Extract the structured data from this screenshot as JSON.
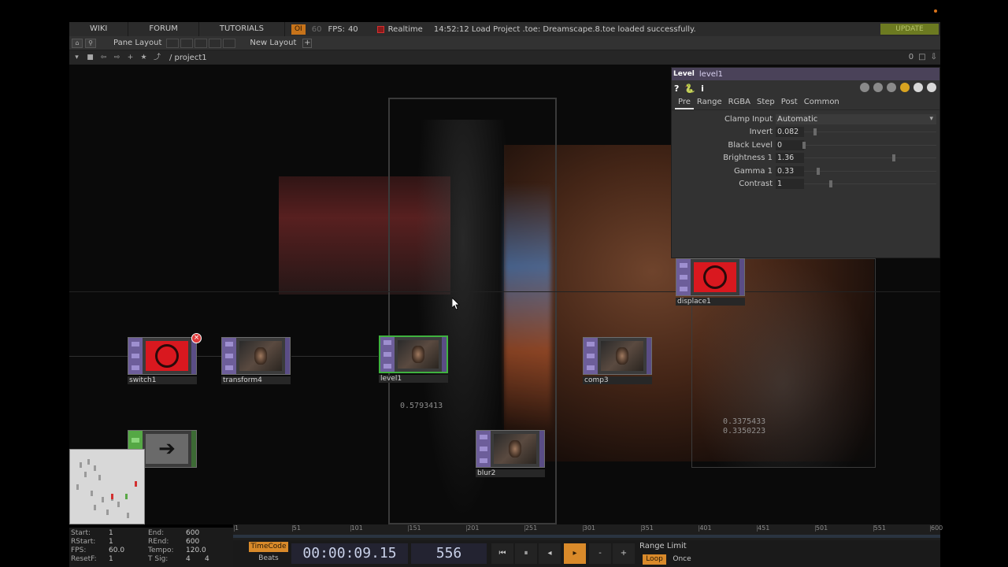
{
  "menubar": {
    "wiki": "WIKI",
    "forum": "FORUM",
    "tutorials": "TUTORIALS",
    "oi": "OI",
    "sixty": "60",
    "fps_label": "FPS:",
    "fps_value": "40",
    "realtime": "Realtime",
    "status": "14:52:12 Load Project .toe: Dreamscape.8.toe loaded successfully.",
    "update": "UPDATE"
  },
  "panebar": {
    "pane_layout": "Pane Layout",
    "new_layout": "New Layout",
    "plus": "+"
  },
  "pathbar": {
    "path": "/ project1",
    "counter": "0"
  },
  "network": {
    "readout_center": "0.5793413",
    "readout_right_1": "0.3375433",
    "readout_right_2": "0.3350223"
  },
  "ops": {
    "switch1": "switch1",
    "transform4": "transform4",
    "level1": "level1",
    "comp3": "comp3",
    "blur2": "blur2",
    "displace1": "displace1"
  },
  "param": {
    "type": "Level",
    "name": "level1",
    "tabs": [
      "Pre",
      "Range",
      "RGBA",
      "Step",
      "Post",
      "Common"
    ],
    "clamp_input": {
      "label": "Clamp Input",
      "value": "Automatic"
    },
    "invert": {
      "label": "Invert",
      "value": "0.082",
      "level": 0.082
    },
    "black_level": {
      "label": "Black Level",
      "value": "0",
      "level": 0.0
    },
    "brightness": {
      "label": "Brightness 1",
      "value": "1.36",
      "level": 0.68
    },
    "gamma": {
      "label": "Gamma 1",
      "value": "0.33",
      "level": 0.11
    },
    "contrast": {
      "label": "Contrast",
      "value": "1",
      "level": 0.2
    }
  },
  "ruler": {
    "ticks": [
      "1",
      "51",
      "101",
      "151",
      "201",
      "251",
      "301",
      "351",
      "401",
      "451",
      "501",
      "551",
      "600"
    ]
  },
  "info": {
    "start_k": "Start:",
    "start_v": "1",
    "rstart_k": "RStart:",
    "rstart_v": "1",
    "fps_k": "FPS:",
    "fps_v": "60.0",
    "resetf_k": "ResetF:",
    "resetf_v": "1",
    "end_k": "End:",
    "end_v": "600",
    "rend_k": "REnd:",
    "rend_v": "600",
    "tempo_k": "Tempo:",
    "tempo_v": "120.0",
    "tsig_k": "T Sig:",
    "tsig_v1": "4",
    "tsig_v2": "4"
  },
  "transport": {
    "timecode_btn": "TimeCode",
    "beats_btn": "Beats",
    "timecode": "00:00:09.15",
    "frame": "556",
    "range_limit": "Range Limit",
    "loop": "Loop",
    "once": "Once"
  }
}
